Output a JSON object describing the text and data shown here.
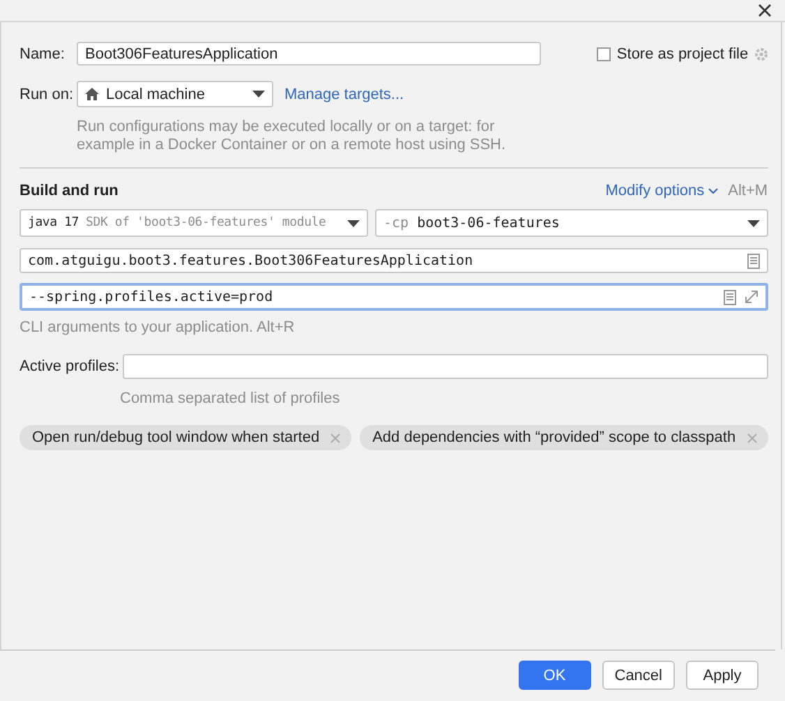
{
  "name": {
    "label": "Name:",
    "value": "Boot306FeaturesApplication"
  },
  "store_as_project_file": {
    "label": "Store as project file",
    "checked": false
  },
  "run_on": {
    "label": "Run on:",
    "value": "Local machine",
    "link": "Manage targets...",
    "help": "Run configurations may be executed locally or on a target: for example in a Docker Container or on a remote host using SSH."
  },
  "build_and_run": {
    "title": "Build and run",
    "modify_options": "Modify options",
    "shortcut": "Alt+M",
    "jdk": {
      "value": "java 17",
      "hint": "SDK of 'boot3-06-features' module"
    },
    "classpath": {
      "prefix": "-cp",
      "value": "boot3-06-features"
    },
    "main_class": "com.atguigu.boot3.features.Boot306FeaturesApplication",
    "program_arguments": {
      "value": "--spring.profiles.active=prod",
      "focused": true,
      "hint": "CLI arguments to your application. Alt+R"
    }
  },
  "active_profiles": {
    "label": "Active profiles:",
    "hint": "Comma separated list of profiles"
  },
  "options": [
    {
      "label": "Open run/debug tool window when started"
    },
    {
      "label": "Add dependencies with “provided” scope to classpath"
    }
  ],
  "buttons": [
    {
      "label": "OK",
      "kind": "primary"
    },
    {
      "label": "Cancel",
      "kind": "secondary"
    },
    {
      "label": "Apply",
      "kind": "secondary"
    }
  ]
}
